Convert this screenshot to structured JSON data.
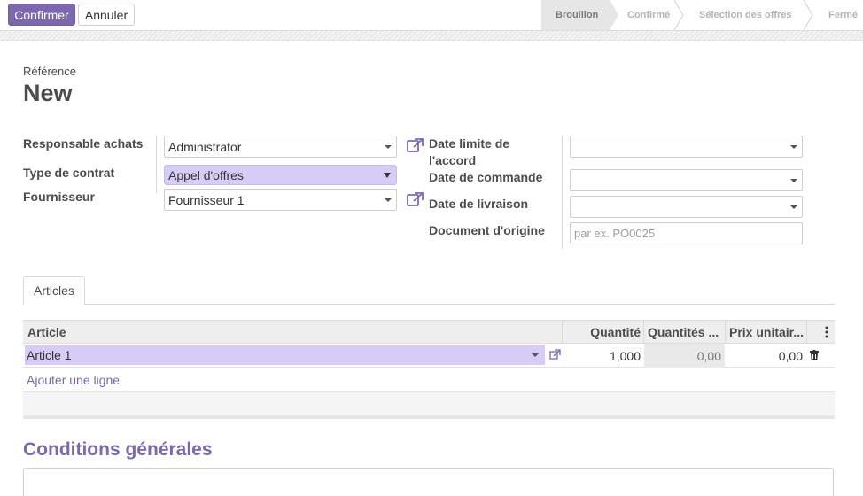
{
  "toolbar": {
    "confirm_label": "Confirmer",
    "cancel_label": "Annuler"
  },
  "statusbar": {
    "stages": [
      "Brouillon",
      "Confirmé",
      "Sélection des offres",
      "Fermé"
    ],
    "active_stage": "Brouillon"
  },
  "header": {
    "reference_label": "Référence",
    "reference_value": "New"
  },
  "form": {
    "buyer_label": "Responsable achats",
    "buyer_value": "Administrator",
    "contract_type_label": "Type de contrat",
    "contract_type_value": "Appel d'offres",
    "vendor_label": "Fournisseur",
    "vendor_value": "Fournisseur 1",
    "deadline_label_line1": "Date limite de",
    "deadline_label_line2": "l'accord",
    "deadline_value": "",
    "order_date_label": "Date de commande",
    "order_date_value": "",
    "delivery_date_label": "Date de livraison",
    "delivery_date_value": "",
    "origin_label": "Document d'origine",
    "origin_placeholder": "par ex. PO0025"
  },
  "tabs": [
    {
      "label": "Articles"
    }
  ],
  "lines_table": {
    "columns": [
      "Article",
      "Quantité",
      "Quantités ...",
      "Prix unitair..."
    ],
    "rows": [
      {
        "article": "Article 1",
        "quantity": "1,000",
        "ordered_qty": "0,00",
        "unit_price": "0,00"
      }
    ],
    "add_line_label": "Ajouter une ligne"
  },
  "terms": {
    "title": "Conditions générales"
  },
  "colors": {
    "accent": "#7c69ad",
    "highlight_field": "#d6ccf5"
  },
  "icons": [
    "external-link-icon",
    "trash-icon",
    "kebab-menu-icon",
    "dropdown-caret-icon"
  ]
}
